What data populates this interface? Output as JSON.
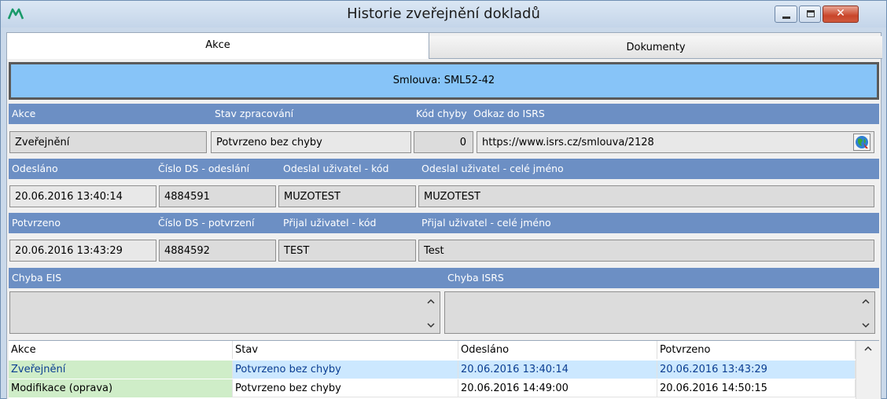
{
  "window": {
    "title": "Historie zveřejnění dokladů",
    "close_glyph": "✕"
  },
  "tabs": [
    {
      "label": "Akce"
    },
    {
      "label": "Dokumenty"
    }
  ],
  "banner": {
    "text": "Smlouva: SML52-42"
  },
  "section1": {
    "headers": {
      "akce": "Akce",
      "stav": "Stav zpracování",
      "kod": "Kód chyby",
      "odkaz": "Odkaz do ISRS"
    },
    "values": {
      "akce": "Zveřejnění",
      "stav": "Potvrzeno bez chyby",
      "kod": "0",
      "odkaz": "https://www.isrs.cz/smlouva/2128"
    }
  },
  "section2": {
    "headers": {
      "odeslano": "Odesláno",
      "cislo": "Číslo DS - odeslání",
      "kod": "Odeslal uživatel - kód",
      "jmeno": "Odeslal uživatel - celé jméno"
    },
    "values": {
      "odeslano": "20.06.2016 13:40:14",
      "cislo": "4884591",
      "kod": "MUZOTEST",
      "jmeno": "MUZOTEST"
    }
  },
  "section3": {
    "headers": {
      "potvrzeno": "Potvrzeno",
      "cislo": "Číslo DS - potvrzení",
      "kod": "Přijal uživatel - kód",
      "jmeno": "Přijal uživatel - celé jméno"
    },
    "values": {
      "potvrzeno": "20.06.2016 13:43:29",
      "cislo": "4884592",
      "kod": "TEST",
      "jmeno": "Test"
    }
  },
  "errors": {
    "eis": "Chyba EIS",
    "isrs": "Chyba ISRS"
  },
  "grid": {
    "columns": [
      "Akce",
      "Stav",
      "Odesláno",
      "Potvrzeno"
    ],
    "rows": [
      [
        "Zveřejnění",
        "Potvrzeno bez chyby",
        "20.06.2016 13:40:14",
        "20.06.2016 13:43:29"
      ],
      [
        "Modifikace (oprava)",
        "Potvrzeno bez chyby",
        "20.06.2016 14:49:00",
        "20.06.2016 14:50:15"
      ]
    ]
  },
  "icons": {
    "app": "app-logo-icon",
    "globe": "globe-link-icon"
  },
  "colors": {
    "header_band": "#6c8fc4",
    "banner": "#87c4f8",
    "selected_row": "#cce8ff",
    "action_cell": "#cfedc8"
  }
}
